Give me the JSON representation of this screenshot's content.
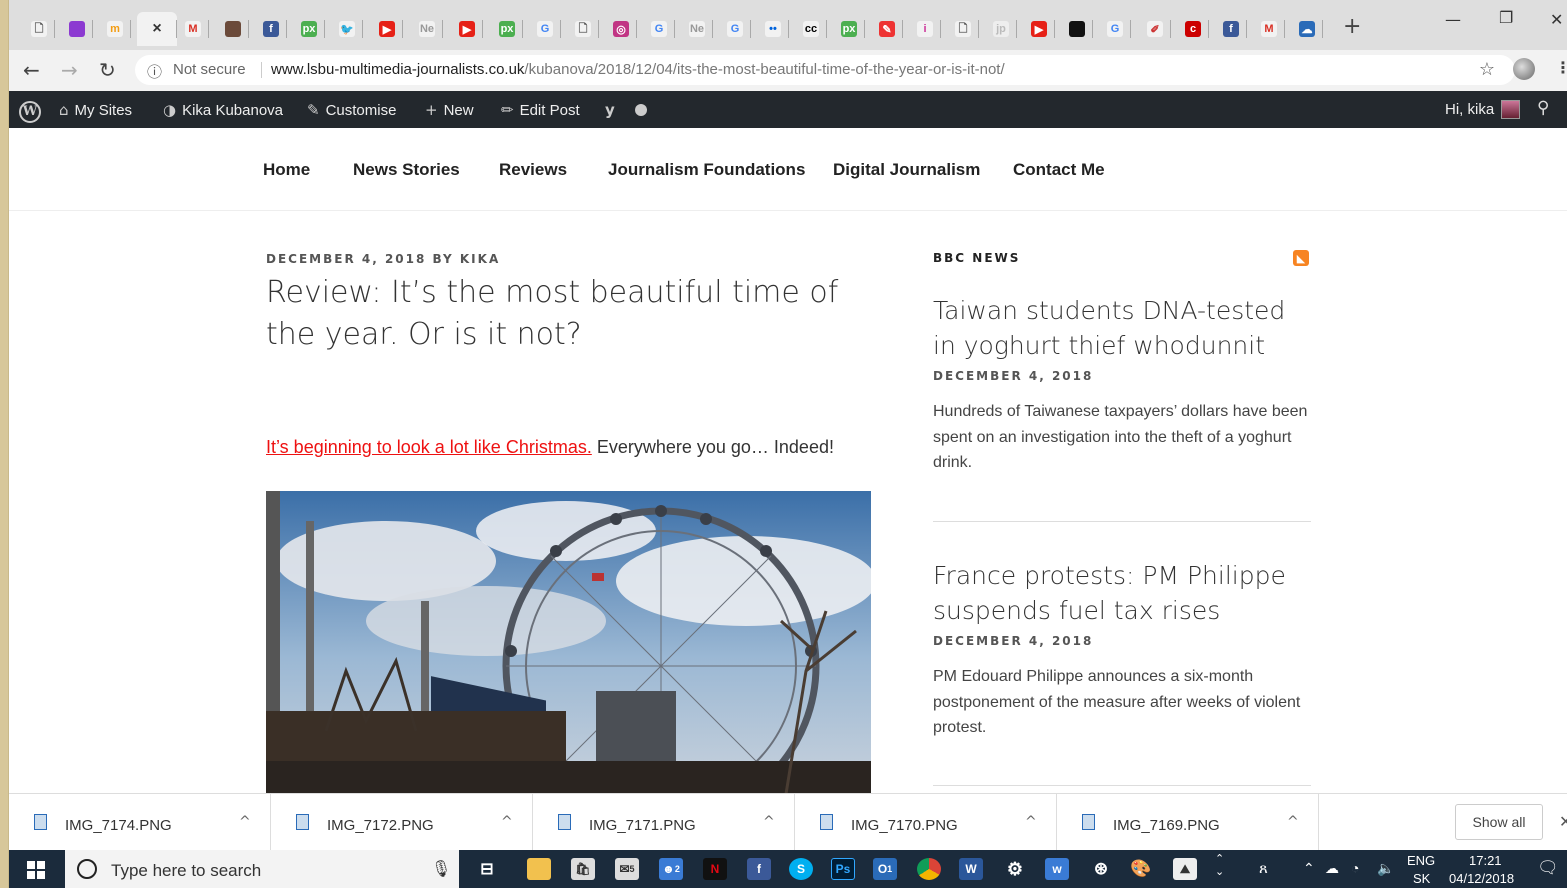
{
  "browser": {
    "tabs": [
      {
        "icon": "blank-page-icon",
        "color": "#f2f2f2",
        "glyph": "🗋",
        "fg": "#555"
      },
      {
        "icon": "purple-square-icon",
        "color": "#8c3ad1",
        "glyph": "",
        "fg": "#fff"
      },
      {
        "icon": "tm-icon",
        "color": "#f2f2f2",
        "glyph": "m",
        "fg": "#f39c12"
      },
      {
        "icon": "close-tab-icon",
        "color": "#f2f2f2",
        "glyph": "×",
        "fg": "#333",
        "active": true
      },
      {
        "icon": "gmail-icon",
        "color": "#f2f2f2",
        "glyph": "M",
        "fg": "#d93025"
      },
      {
        "icon": "person-icon",
        "color": "#6b4a3a",
        "glyph": "",
        "fg": "#fff"
      },
      {
        "icon": "facebook-icon",
        "color": "#3b5998",
        "glyph": "f",
        "fg": "#fff"
      },
      {
        "icon": "px-icon",
        "color": "#4caf50",
        "glyph": "px",
        "fg": "#fff"
      },
      {
        "icon": "twitter-icon",
        "color": "#f2f2f2",
        "glyph": "🐦",
        "fg": "#1da1f2"
      },
      {
        "icon": "youtube-icon",
        "color": "#e62117",
        "glyph": "▶",
        "fg": "#fff"
      },
      {
        "icon": "news-icon",
        "color": "#f2f2f2",
        "glyph": "Ne",
        "fg": "#999"
      },
      {
        "icon": "youtube-icon",
        "color": "#e62117",
        "glyph": "▶",
        "fg": "#fff"
      },
      {
        "icon": "px-icon",
        "color": "#4caf50",
        "glyph": "px",
        "fg": "#fff"
      },
      {
        "icon": "google-icon",
        "color": "#f2f2f2",
        "glyph": "G",
        "fg": "#4285f4"
      },
      {
        "icon": "blank-page-icon",
        "color": "#f2f2f2",
        "glyph": "🗋",
        "fg": "#555"
      },
      {
        "icon": "instagram-icon",
        "color": "#c13584",
        "glyph": "◎",
        "fg": "#fff"
      },
      {
        "icon": "google-icon",
        "color": "#f2f2f2",
        "glyph": "G",
        "fg": "#4285f4"
      },
      {
        "icon": "news-icon",
        "color": "#f2f2f2",
        "glyph": "Ne",
        "fg": "#999"
      },
      {
        "icon": "google-icon",
        "color": "#f2f2f2",
        "glyph": "G",
        "fg": "#4285f4"
      },
      {
        "icon": "flickr-icon",
        "color": "#f2f2f2",
        "glyph": "••",
        "fg": "#0063dc"
      },
      {
        "icon": "creative-commons-icon",
        "color": "#f2f2f2",
        "glyph": "cc",
        "fg": "#000"
      },
      {
        "icon": "px-icon",
        "color": "#4caf50",
        "glyph": "px",
        "fg": "#fff"
      },
      {
        "icon": "red-app-icon",
        "color": "#e33",
        "glyph": "✎",
        "fg": "#fff"
      },
      {
        "icon": "info-icon",
        "color": "#f2f2f2",
        "glyph": "i",
        "fg": "#c39"
      },
      {
        "icon": "blank-page-icon",
        "color": "#f2f2f2",
        "glyph": "🗋",
        "fg": "#555"
      },
      {
        "icon": "faded-icon",
        "color": "#eee",
        "glyph": "jp",
        "fg": "#bbb"
      },
      {
        "icon": "youtube-icon",
        "color": "#e62117",
        "glyph": "▶",
        "fg": "#fff"
      },
      {
        "icon": "black-red-icon",
        "color": "#111",
        "glyph": "",
        "fg": "#e00"
      },
      {
        "icon": "google-icon",
        "color": "#f2f2f2",
        "glyph": "G",
        "fg": "#4285f4"
      },
      {
        "icon": "sketch-icon",
        "color": "#f2f2f2",
        "glyph": "✐",
        "fg": "#c33"
      },
      {
        "icon": "red-circle-icon",
        "color": "#c00",
        "glyph": "c",
        "fg": "#fff"
      },
      {
        "icon": "facebook-icon",
        "color": "#3b5998",
        "glyph": "f",
        "fg": "#fff"
      },
      {
        "icon": "gmail-icon",
        "color": "#f2f2f2",
        "glyph": "M",
        "fg": "#d93025"
      },
      {
        "icon": "cloud-icon",
        "color": "#2a6bb8",
        "glyph": "☁",
        "fg": "#fff"
      }
    ],
    "window_controls": {
      "minimize": "—",
      "restore": "❐",
      "close": "✕"
    },
    "not_secure": "Not secure",
    "url_host": "www.lsbu-multimedia-journalists.co.uk",
    "url_path": "/kubanova/2018/12/04/its-the-most-beautiful-time-of-the-year-or-is-it-not/"
  },
  "adminbar": {
    "my_sites": "My Sites",
    "site_name": "Kika Kubanova",
    "customise": "Customise",
    "new": "New",
    "edit_post": "Edit Post",
    "greeting": "Hi, kika"
  },
  "nav": [
    "Home",
    "News Stories",
    "Reviews",
    "Journalism Foundations",
    "Digital Journalism",
    "Contact Me"
  ],
  "post": {
    "meta": "DECEMBER 4, 2018 BY KIKA",
    "title": "Review: It’s the most beautiful time of the year. Or is it not?",
    "link_text": "It’s beginning to look a lot like Christmas.",
    "lead_rest": " Everywhere you go… Indeed!"
  },
  "sidebar": {
    "widget_title": "BBC NEWS",
    "stories": [
      {
        "title": "Taiwan students DNA-tested in yoghurt thief whodunnit",
        "date": "DECEMBER 4, 2018",
        "excerpt": "Hundreds of Taiwanese taxpayers’ dollars have been spent on an investigation into the theft of a yoghurt drink."
      },
      {
        "title": "France protests: PM Philippe suspends fuel tax rises",
        "date": "DECEMBER 4, 2018",
        "excerpt": "PM Edouard Philippe announces a six-month postponement of the measure after weeks of violent protest."
      }
    ]
  },
  "downloads": {
    "files": [
      "IMG_7174.PNG",
      "IMG_7172.PNG",
      "IMG_7171.PNG",
      "IMG_7170.PNG",
      "IMG_7169.PNG"
    ],
    "show_all": "Show all"
  },
  "taskbar": {
    "search_placeholder": "Type here to search",
    "lang": "ENG",
    "region": "SK",
    "time": "17:21",
    "date": "04/12/2018",
    "mail_badge": "5",
    "app_badge": "2",
    "outlook_badge": "1"
  }
}
